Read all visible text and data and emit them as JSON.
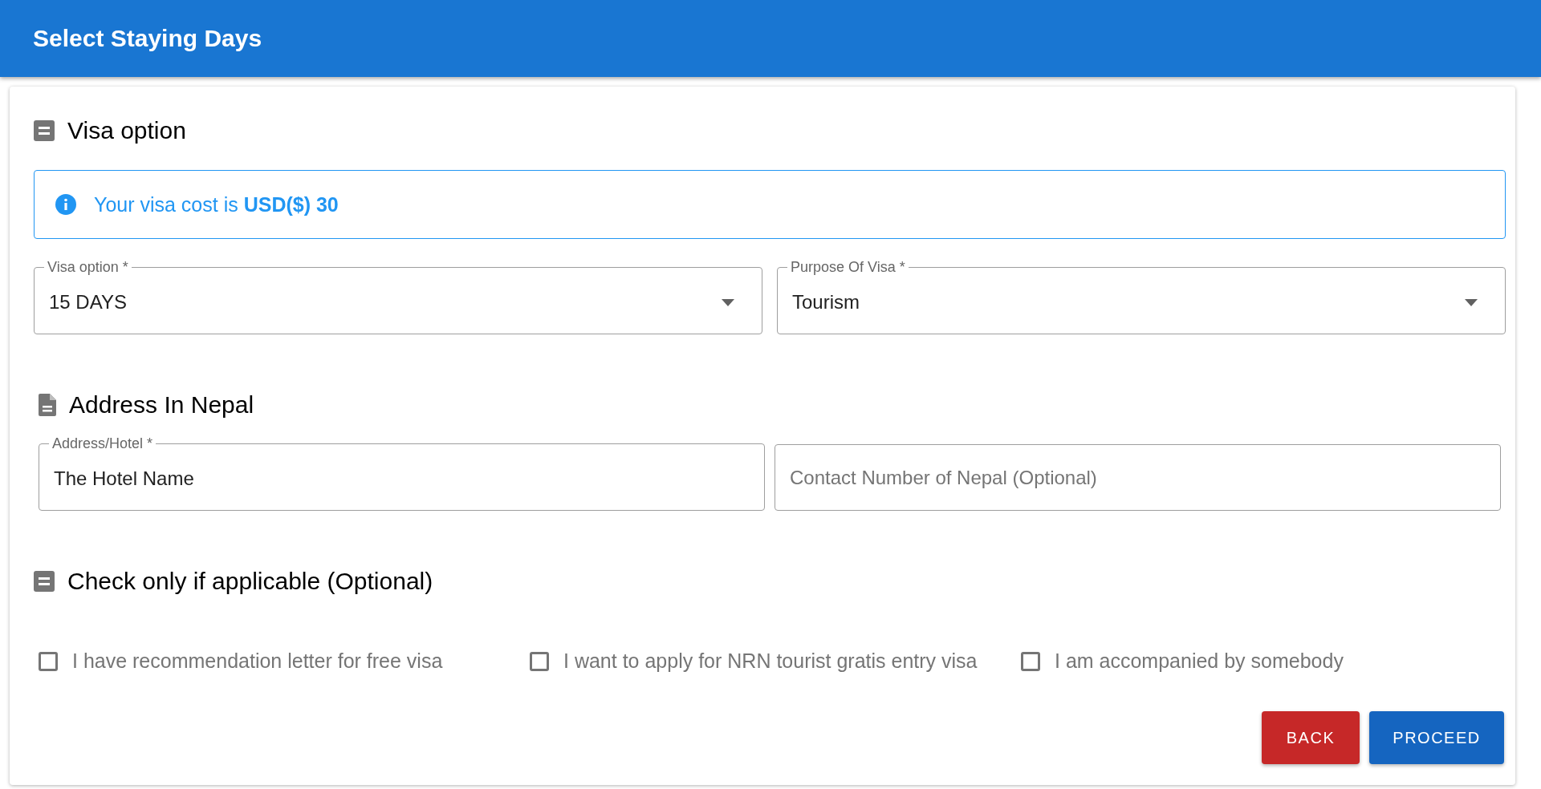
{
  "header": {
    "title": "Select Staying Days"
  },
  "sections": [
    {
      "title": "Visa option",
      "alert": {
        "text": "Your visa cost is **USD($) 30**"
      },
      "fields": [
        {
          "kind": "select",
          "label": "Visa option *",
          "value": "15 DAYS"
        },
        {
          "kind": "select",
          "label": "Purpose Of Visa *",
          "value": "Tourism"
        }
      ]
    },
    {
      "title": "Address In Nepal",
      "fields": [
        {
          "kind": "text",
          "label": "Address/Hotel *",
          "value": "The Hotel Name"
        },
        {
          "kind": "text",
          "placeholder": "Contact Number of Nepal (Optional)"
        }
      ]
    },
    {
      "title": "Check only if applicable (Optional)",
      "checkboxes": [
        {
          "label": "I have recommendation letter for free visa",
          "checked": false
        },
        {
          "label": "I want to apply for NRN tourist gratis entry visa",
          "checked": false
        },
        {
          "label": "I am accompanied by somebody",
          "checked": false
        }
      ]
    }
  ],
  "buttons": [
    {
      "kind": "back",
      "label": "BACK"
    },
    {
      "kind": "proceed",
      "label": "PROCEED"
    }
  ]
}
